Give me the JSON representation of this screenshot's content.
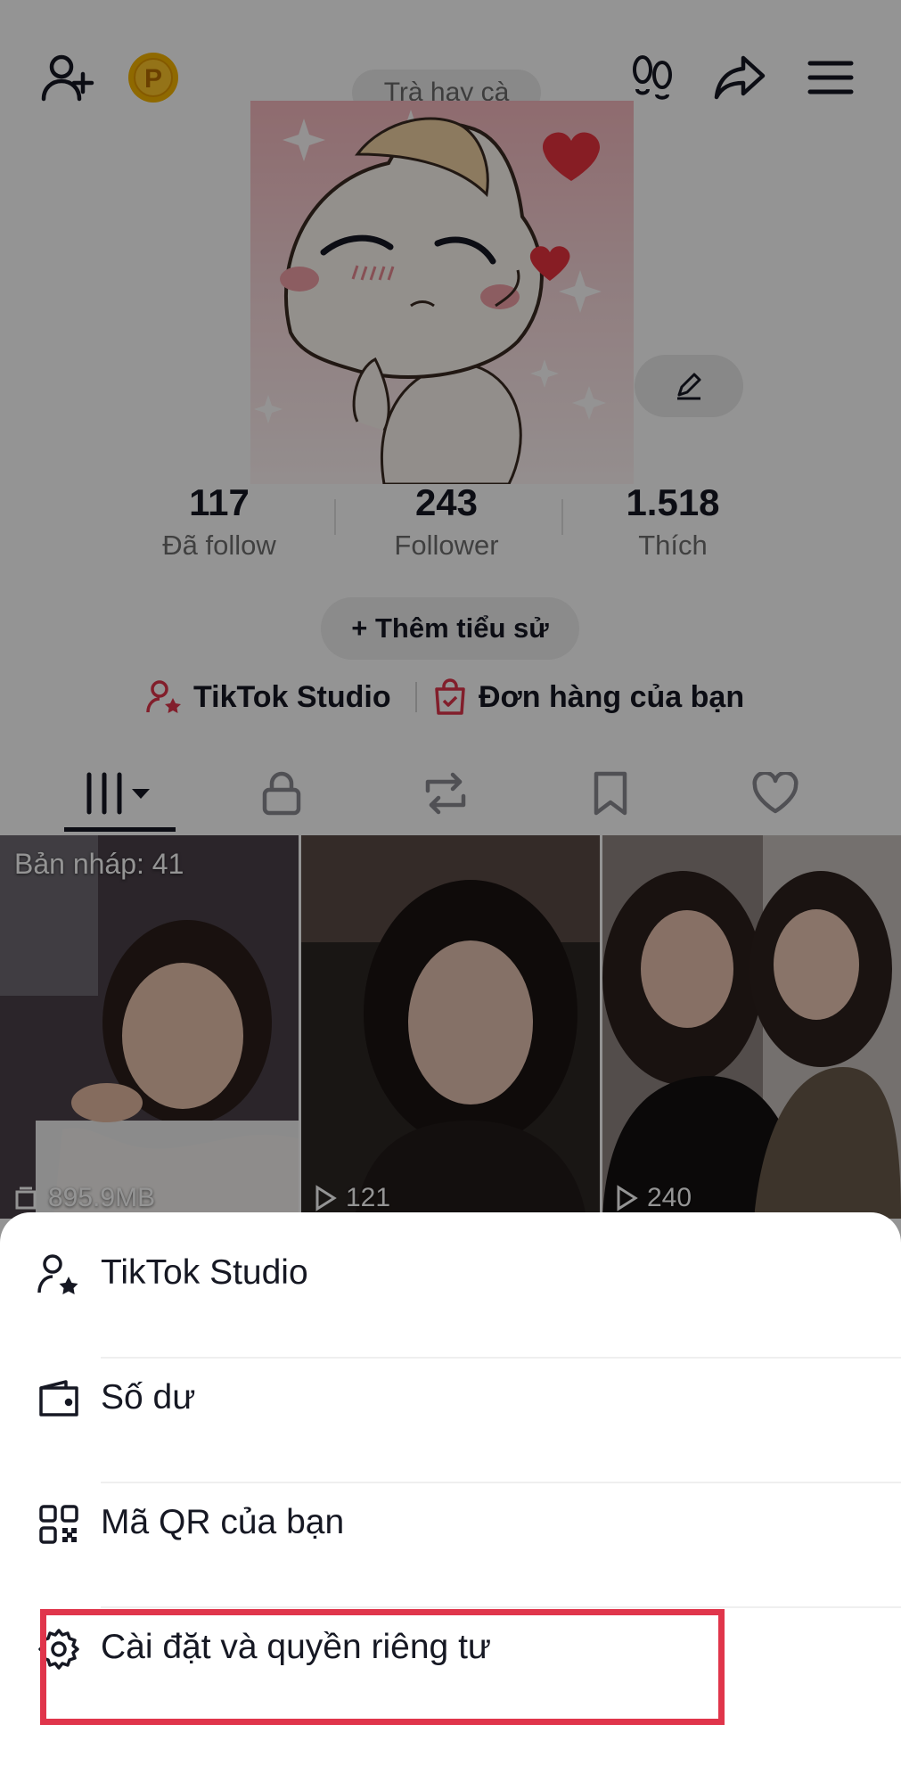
{
  "header": {
    "search_placeholder": "Trà hay cà",
    "coin_letter": "P"
  },
  "stats": [
    {
      "value": "117",
      "label": "Đã follow"
    },
    {
      "value": "243",
      "label": "Follower"
    },
    {
      "value": "1.518",
      "label": "Thích"
    }
  ],
  "bio_button_label": "+ Thêm tiểu sử",
  "quick_links": {
    "studio": "TikTok Studio",
    "orders": "Đơn hàng của bạn"
  },
  "videos": [
    {
      "label": "Bản nháp: 41",
      "count": "895.9MB"
    },
    {
      "label": "",
      "count": "121"
    },
    {
      "label": "",
      "count": "240"
    }
  ],
  "menu": {
    "items": [
      {
        "label": "TikTok Studio",
        "icon": "person-star-icon"
      },
      {
        "label": "Số dư",
        "icon": "wallet-icon"
      },
      {
        "label": "Mã QR của bạn",
        "icon": "qr-code-icon"
      },
      {
        "label": "Cài đặt và quyền riêng tư",
        "icon": "gear-icon"
      }
    ]
  },
  "colors": {
    "accent_red": "#e0354b",
    "coin_gold": "#f7b500"
  }
}
